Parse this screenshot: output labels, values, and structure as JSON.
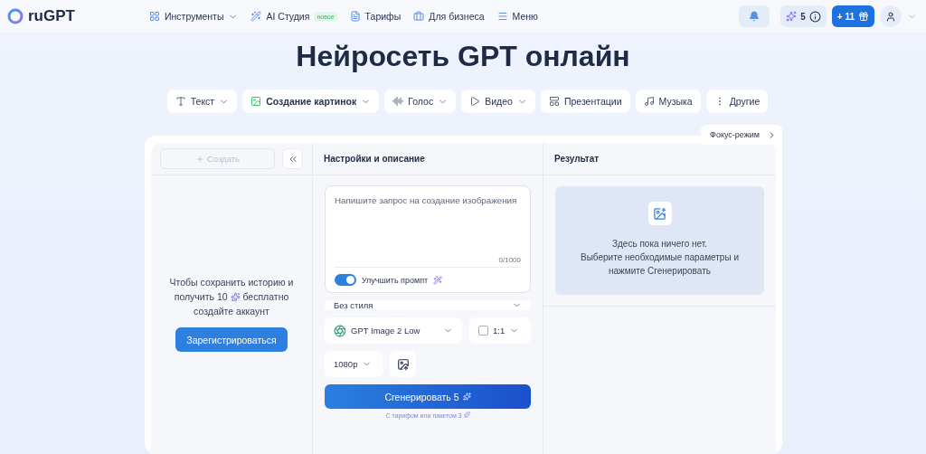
{
  "header": {
    "logo": "ruGPT",
    "nav": [
      {
        "label": "Инструменты",
        "has_menu": true
      },
      {
        "label": "AI Студия",
        "badge": "новое",
        "has_menu": false
      },
      {
        "label": "Тарифы",
        "has_menu": false
      },
      {
        "label": "Для бизнеса",
        "has_menu": false
      },
      {
        "label": "Меню",
        "has_menu": false
      }
    ],
    "credits": "5",
    "bonus": "+ 11"
  },
  "title": "Нейросеть GPT онлайн",
  "tabs": [
    {
      "label": "Текст",
      "has_menu": true,
      "selected": false
    },
    {
      "label": "Создание картинок",
      "has_menu": true,
      "selected": true
    },
    {
      "label": "Голос",
      "has_menu": true,
      "selected": false
    },
    {
      "label": "Видео",
      "has_menu": true,
      "selected": false
    },
    {
      "label": "Презентации",
      "has_menu": false,
      "selected": false
    },
    {
      "label": "Музыка",
      "has_menu": false,
      "selected": false
    },
    {
      "label": "Другие",
      "has_menu": false,
      "selected": false
    }
  ],
  "focus_mode": "Фокус-режим",
  "history": {
    "create": "Создать",
    "create_disabled": true,
    "prompt_before": "Чтобы сохранить историю и получить 10",
    "prompt_after": "бесплатно создайте аккаунт",
    "register": "Зарегистрироваться"
  },
  "settings": {
    "heading": "Настройки и описание",
    "placeholder": "Напишите запрос на создание изображения",
    "counter": "0/1000",
    "enhance": {
      "label": "Улучшить промпт",
      "on": true
    },
    "style": "Без стиля",
    "model": "GPT Image 2 Low",
    "ratio": "1:1",
    "resolution": "1080p",
    "generate": "Сгенерировать",
    "generate_cost": "5",
    "note": "С тарифом или пакетом 3"
  },
  "result": {
    "heading": "Результат",
    "empty_lines": [
      "Здесь пока ничего нет.",
      "Выберите необходимые параметры и",
      "нажмите Сгенерировать"
    ]
  }
}
